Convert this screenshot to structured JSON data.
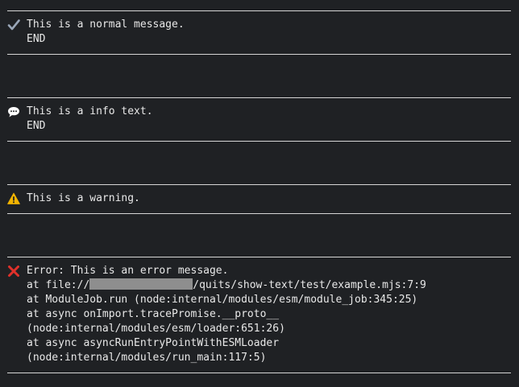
{
  "messages": {
    "normal": {
      "icon": "check-mark-icon",
      "text": "This is a normal message.",
      "end": "END"
    },
    "info": {
      "icon": "speech-bubble-icon",
      "text": "This is a info text.",
      "end": "END"
    },
    "warning": {
      "icon": "warning-icon",
      "text": "This is a warning."
    },
    "error": {
      "icon": "cross-mark-icon",
      "title": "Error: This is an error message.",
      "trace_prefix": "at file://",
      "trace_path": "/quits/show-text/test/example.mjs:7:9",
      "trace": [
        "at ModuleJob.run (node:internal/modules/esm/module_job:345:25)",
        "at async onImport.tracePromise.__proto__",
        "(node:internal/modules/esm/loader:651:26)",
        "at async asyncRunEntryPointWithESMLoader",
        "(node:internal/modules/run_main:117:5)"
      ]
    }
  },
  "colors": {
    "background": "#1f2124",
    "text": "#e8e8e8",
    "rule": "#d6d6d6",
    "check": "#9aa7b8",
    "info_bubble": "#ffffff",
    "warning": "#f2b400",
    "error": "#e0312b",
    "redaction": "#8e8e8e"
  }
}
